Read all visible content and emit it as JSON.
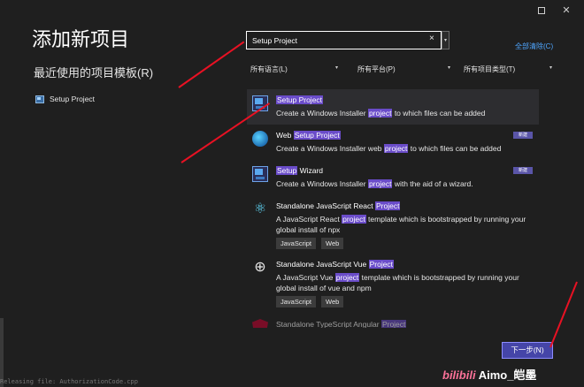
{
  "window": {
    "title": "添加新项目",
    "restore_label": "",
    "close_label": "✕"
  },
  "recent": {
    "heading": "最近使用的项目模板(R)",
    "items": [
      {
        "label": "Setup Project",
        "icon": "setup-project-icon"
      }
    ]
  },
  "search": {
    "value": "Setup Project",
    "clear_label": "×",
    "dropdown_label": "▾",
    "clear_all_label": "全部清除(C)"
  },
  "filters": {
    "language": "所有语言(L)",
    "platform": "所有平台(P)",
    "project_type": "所有项目类型(T)",
    "arrow": "▾"
  },
  "results": [
    {
      "title_parts": [
        "",
        "Setup Project",
        ""
      ],
      "desc_parts": [
        "Create a Windows Installer ",
        "project",
        " to which files can be added"
      ],
      "badge": "",
      "tags": [],
      "icon": "setup-project-icon"
    },
    {
      "title_parts": [
        "Web ",
        "Setup Project",
        ""
      ],
      "desc_parts": [
        "Create a Windows Installer web ",
        "project",
        " to which files can be added"
      ],
      "badge": "新建",
      "tags": [],
      "icon": "globe-icon"
    },
    {
      "title_parts": [
        "",
        "Setup",
        " Wizard"
      ],
      "desc_parts": [
        "Create a Windows Installer ",
        "project",
        " with the aid of a wizard."
      ],
      "badge": "新建",
      "tags": [],
      "icon": "setup-wizard-icon"
    },
    {
      "title_parts": [
        "Standalone JavaScript React ",
        "Project",
        ""
      ],
      "desc_parts": [
        "A JavaScript React ",
        "project",
        " template which is bootstrapped by running your global install of npx"
      ],
      "badge": "",
      "tags": [
        "JavaScript",
        "Web"
      ],
      "icon": "react-icon"
    },
    {
      "title_parts": [
        "Standalone JavaScript Vue ",
        "Project",
        ""
      ],
      "desc_parts": [
        "A JavaScript Vue ",
        "project",
        " template which is bootstrapped by running your global install of vue and npm"
      ],
      "badge": "",
      "tags": [
        "JavaScript",
        "Web"
      ],
      "icon": "vue-icon"
    },
    {
      "title_parts": [
        "Standalone TypeScript Angular ",
        "Project",
        ""
      ],
      "desc_parts": [
        "",
        "",
        ""
      ],
      "badge": "",
      "tags": [],
      "icon": "angular-icon"
    }
  ],
  "footer": {
    "next_label": "下一步(N)",
    "status_text": "Releasing file: AuthorizationCode.cpp"
  },
  "watermark": {
    "brand": "bilibili",
    "text": "Aimo_皑墨"
  },
  "colors": {
    "background": "#1f1f1f",
    "highlight": "#6a4cc9",
    "accent": "#4545a8",
    "link": "#4fa6ff",
    "annotation_arrow": "#e81123"
  }
}
